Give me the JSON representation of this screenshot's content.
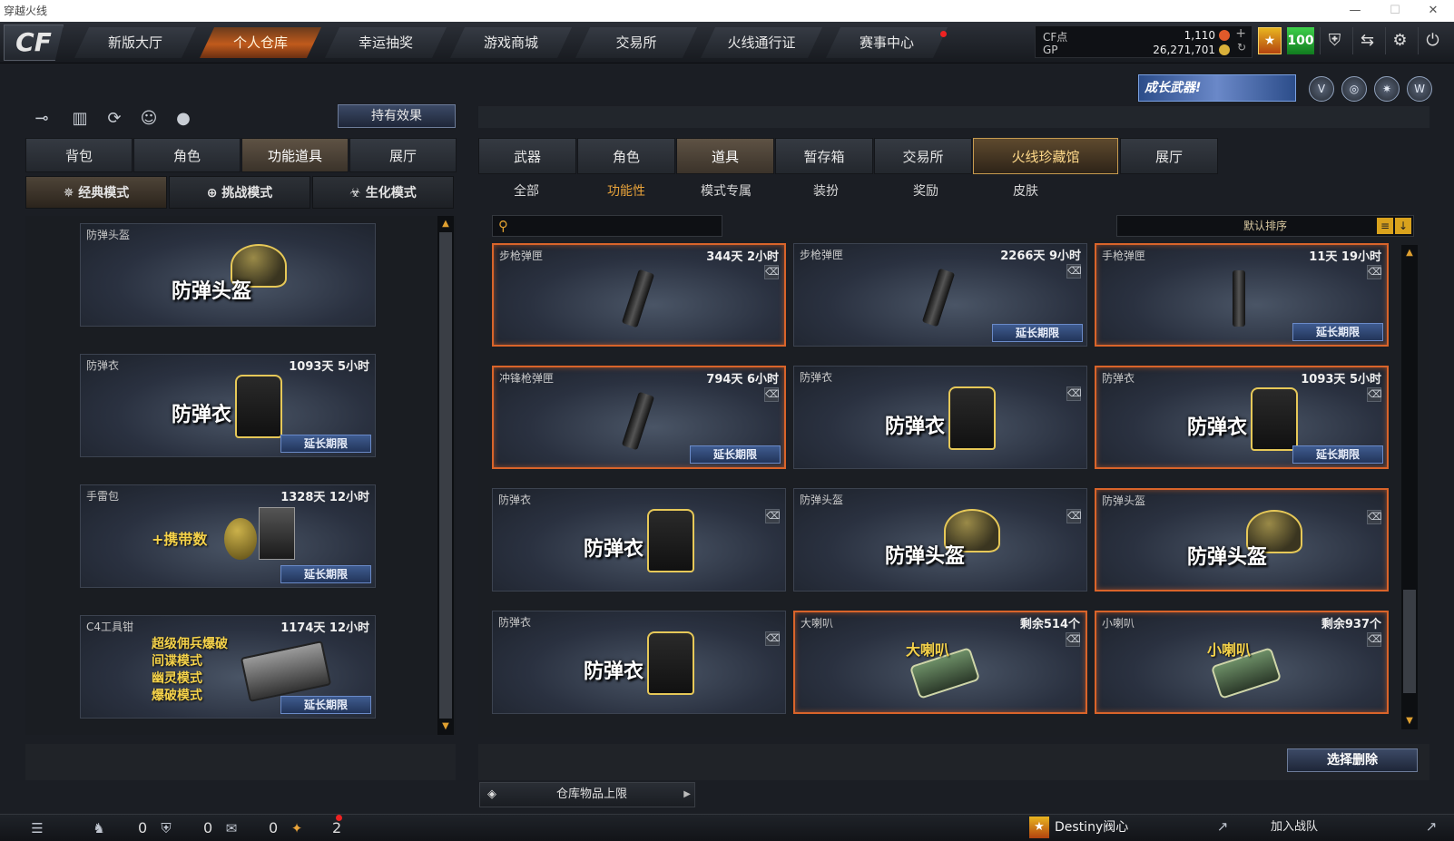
{
  "window": {
    "title": "穿越火线",
    "minimize": "—",
    "maximize": "☐",
    "close": "✕"
  },
  "nav": {
    "logo": "CF",
    "tabs": [
      "新版大厅",
      "个人仓库",
      "幸运抽奖",
      "游戏商城",
      "交易所",
      "火线通行证",
      "赛事中心"
    ],
    "active_index": 1
  },
  "currency": {
    "cf_label": "CF点",
    "cf_value": "1,110",
    "gp_label": "GP",
    "gp_value": "26,271,701",
    "level": "100",
    "rank_icon": "rank-badge-icon"
  },
  "top_icons": [
    "shield-icon",
    "exit-arrow-icon",
    "gear-icon",
    "power-icon"
  ],
  "growth_banner": "成长武器!",
  "left": {
    "toolbar_icons": [
      "key-icon",
      "chart-icon",
      "refresh-icon",
      "user-icon",
      "grenade-icon"
    ],
    "hold_effect_button": "持有效果",
    "tabs": [
      "背包",
      "角色",
      "功能道具",
      "展厅"
    ],
    "active_tab": 2,
    "mode_tabs": [
      "经典模式",
      "挑战模式",
      "生化模式"
    ],
    "active_mode": 0,
    "items": [
      {
        "category": "防弹头盔",
        "timer": "",
        "art_text": "防弹头盔",
        "art": "helmet",
        "extend": ""
      },
      {
        "category": "防弹衣",
        "timer": "1093天 5小时",
        "art_text": "防弹衣",
        "art": "vest",
        "extend": "延长期限"
      },
      {
        "category": "手雷包",
        "timer": "1328天 12小时",
        "art_text": "+携带数",
        "art": "grenade",
        "extend": "延长期限"
      },
      {
        "category": "C4工具钳",
        "timer": "1174天 12小时",
        "art_lines": [
          "超级佣兵爆破",
          "间谍模式",
          "幽灵模式",
          "爆破模式"
        ],
        "art": "c4",
        "extend": "延长期限"
      }
    ]
  },
  "right": {
    "tabs": [
      "武器",
      "角色",
      "道具",
      "暂存箱",
      "交易所",
      "火线珍藏馆",
      "展厅"
    ],
    "active_tab": 2,
    "gold_tab": 5,
    "filters": [
      "全部",
      "功能性",
      "模式专属",
      "装扮",
      "奖励",
      "皮肤"
    ],
    "active_filter": 1,
    "search_placeholder": "",
    "sort_label": "默认排序",
    "items": [
      {
        "category": "步枪弹匣",
        "timer": "344天 2小时",
        "art": "mag",
        "art_text": "",
        "extend": "",
        "selected": true
      },
      {
        "category": "步枪弹匣",
        "timer": "2266天 9小时",
        "art": "mag",
        "art_text": "",
        "extend": "延长期限",
        "selected": false
      },
      {
        "category": "手枪弹匣",
        "timer": "11天 19小时",
        "art": "mag-straight",
        "art_text": "",
        "extend": "延长期限",
        "selected": true
      },
      {
        "category": "冲锋枪弹匣",
        "timer": "794天 6小时",
        "art": "mag",
        "art_text": "",
        "extend": "延长期限",
        "selected": true
      },
      {
        "category": "防弹衣",
        "timer": "",
        "art": "vest",
        "art_text": "防弹衣",
        "extend": "",
        "selected": false
      },
      {
        "category": "防弹衣",
        "timer": "1093天 5小时",
        "art": "vest",
        "art_text": "防弹衣",
        "extend": "延长期限",
        "selected": true
      },
      {
        "category": "防弹衣",
        "timer": "",
        "art": "vest",
        "art_text": "防弹衣",
        "extend": "",
        "selected": false
      },
      {
        "category": "防弹头盔",
        "timer": "",
        "art": "helmet",
        "art_text": "防弹头盔",
        "extend": "",
        "selected": false
      },
      {
        "category": "防弹头盔",
        "timer": "",
        "art": "helmet",
        "art_text": "防弹头盔",
        "extend": "",
        "selected": true
      },
      {
        "category": "防弹衣",
        "timer": "",
        "art": "vest",
        "art_text": "防弹衣",
        "extend": "",
        "selected": false
      },
      {
        "category": "大喇叭",
        "timer": "剩余514个",
        "art": "speaker",
        "art_text": "大喇叭",
        "extend": "",
        "selected": true
      },
      {
        "category": "小喇叭",
        "timer": "剩余937个",
        "art": "speaker",
        "art_text": "小喇叭",
        "extend": "",
        "selected": true
      }
    ],
    "delete_button": "选择删除",
    "capacity_label": "仓库物品上限"
  },
  "statusbar": {
    "counts": [
      "0",
      "0",
      "0",
      "2"
    ],
    "player_name": "Destiny阀心",
    "join_clan": "加入战队"
  },
  "colors": {
    "accent": "#c05a1c",
    "selected_border": "#d9642a",
    "gold": "#e8a33a",
    "extend_btn": "#3f5b8f",
    "level_green": "#3ed04a"
  }
}
